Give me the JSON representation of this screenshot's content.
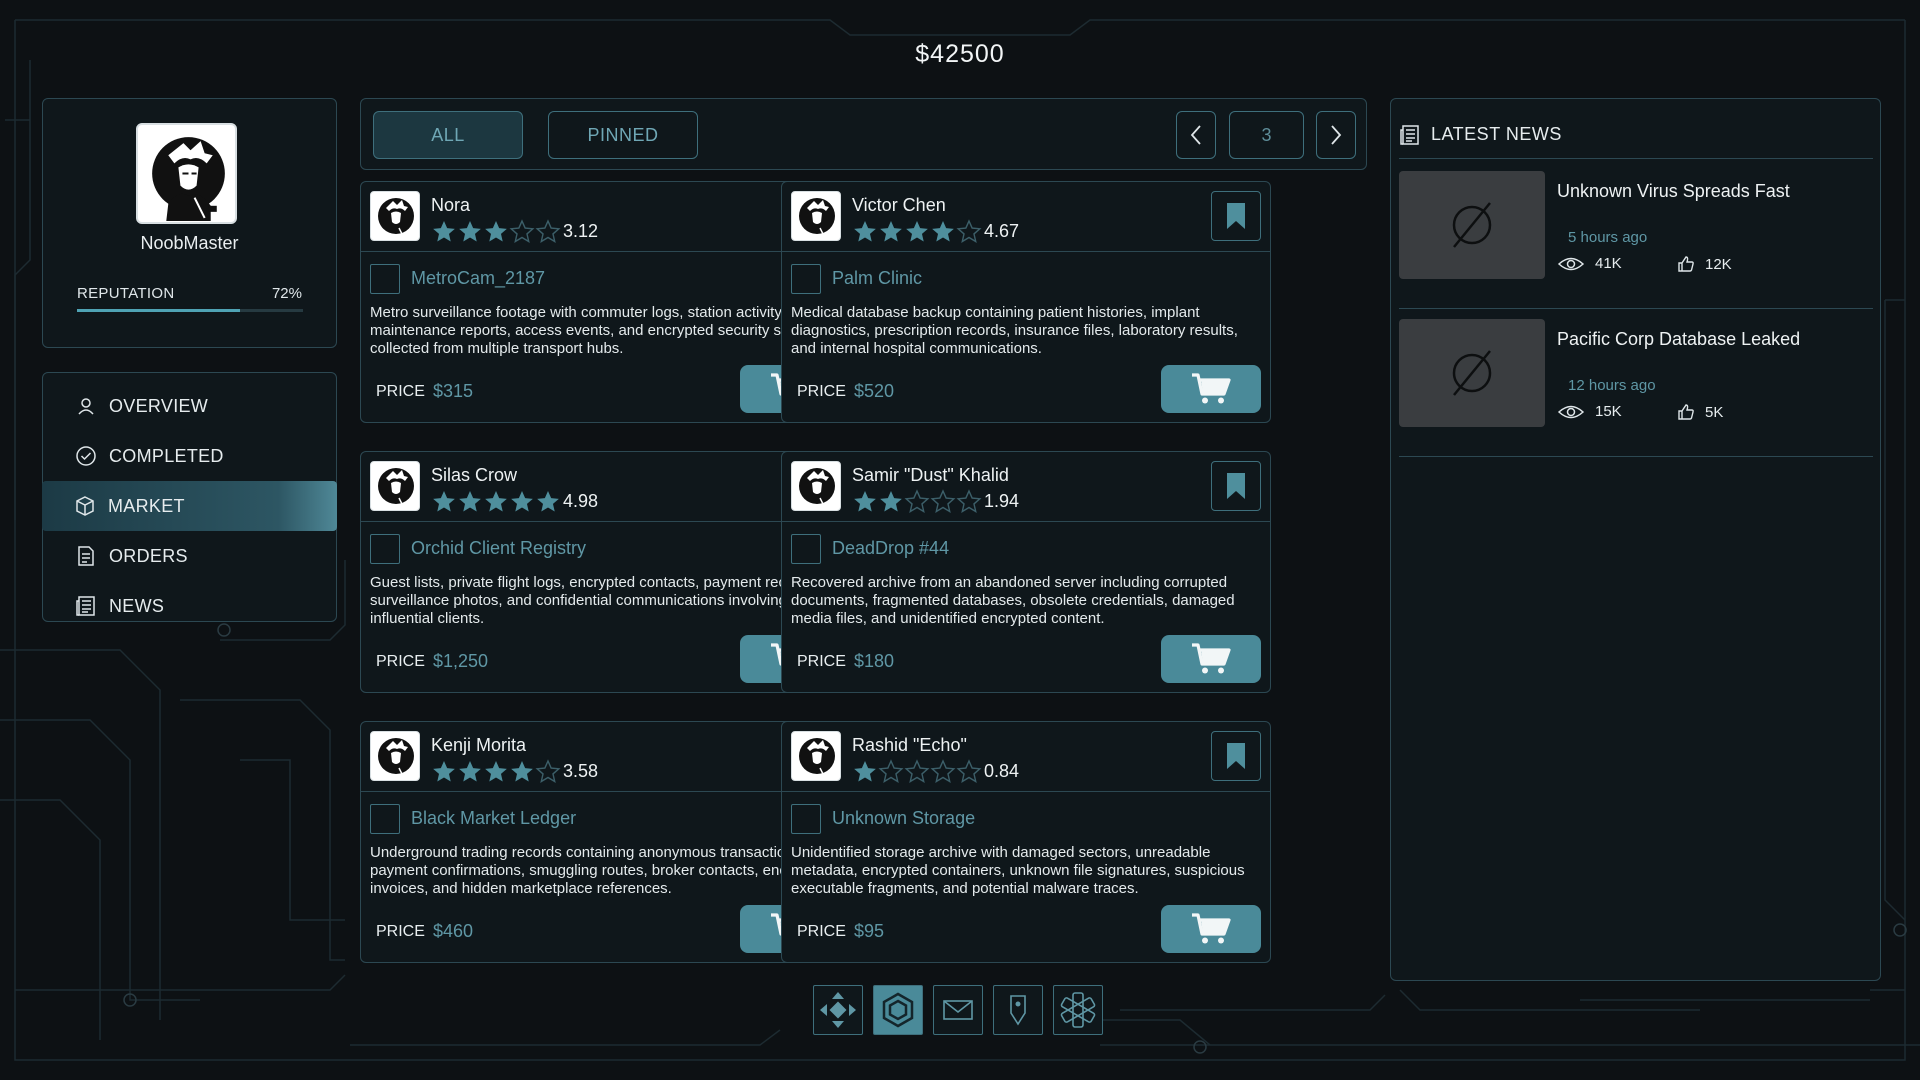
{
  "balance": "$42500",
  "profile": {
    "username": "NoobMaster",
    "reputation_label": "REPUTATION",
    "reputation_value": "72%",
    "reputation_fraction": 0.72
  },
  "nav": [
    {
      "label": "OVERVIEW",
      "icon": "user-icon"
    },
    {
      "label": "COMPLETED",
      "icon": "check-circle-icon"
    },
    {
      "label": "MARKET",
      "icon": "cube-icon",
      "active": true
    },
    {
      "label": "ORDERS",
      "icon": "document-icon"
    },
    {
      "label": "NEWS",
      "icon": "newspaper-icon"
    }
  ],
  "market": {
    "tabs": {
      "all": "ALL",
      "pinned": "PINNED"
    },
    "page": "3",
    "price_label": "PRICE",
    "listings": [
      {
        "seller": "Nora",
        "rating": "3.12",
        "stars": 3,
        "title": "MetroCam_2187",
        "desc": "Metro surveillance footage with commuter logs, station activity records, maintenance reports, access events, and encrypted security snapshots collected from multiple transport hubs.",
        "price": "$315"
      },
      {
        "seller": "Victor Chen",
        "rating": "4.67",
        "stars": 4,
        "title": "Palm Clinic",
        "desc": "Medical database backup containing patient histories, implant diagnostics, prescription records, insurance files, laboratory results, and internal hospital communications.",
        "price": "$520"
      },
      {
        "seller": "Silas Crow",
        "rating": "4.98",
        "stars": 5,
        "title": "Orchid Client Registry",
        "desc": "Guest lists, private flight logs, encrypted contacts, payment records, surveillance photos, and confidential communications involving influential clients.",
        "price": "$1,250"
      },
      {
        "seller": "Samir \"Dust\" Khalid",
        "rating": "1.94",
        "stars": 2,
        "title": "DeadDrop #44",
        "desc": "Recovered archive from an abandoned server including corrupted documents, fragmented databases, obsolete credentials, damaged media files, and unidentified encrypted content.",
        "price": "$180"
      },
      {
        "seller": "Kenji Morita",
        "rating": "3.58",
        "stars": 4,
        "title": "Black Market Ledger",
        "desc": "Underground trading records containing anonymous transactions, payment confirmations, smuggling routes, broker contacts, encrypted invoices, and hidden marketplace references.",
        "price": "$460"
      },
      {
        "seller": "Rashid \"Echo\"",
        "rating": "0.84",
        "stars": 1,
        "title": "Unknown Storage",
        "desc": "Unidentified storage archive with damaged sectors, unreadable metadata, encrypted containers, unknown file signatures, suspicious executable fragments, and potential malware traces.",
        "price": "$95"
      }
    ]
  },
  "news": {
    "title": "LATEST NEWS",
    "items": [
      {
        "headline": "Unknown Virus Spreads Fast",
        "time": "5 hours ago",
        "views": "41K",
        "likes": "12K"
      },
      {
        "headline": "Pacific Corp Database Leaked",
        "time": "12 hours ago",
        "views": "15K",
        "likes": "5K"
      }
    ]
  },
  "dock": [
    "directions-icon",
    "hexagon-icon",
    "mail-icon",
    "map-pin-icon",
    "medical-icon"
  ],
  "colors": {
    "accent": "#4a8a99",
    "accent_text": "#5f97a5",
    "border": "#2c4852",
    "background": "#0d1114",
    "star": "#4f8f9d"
  }
}
